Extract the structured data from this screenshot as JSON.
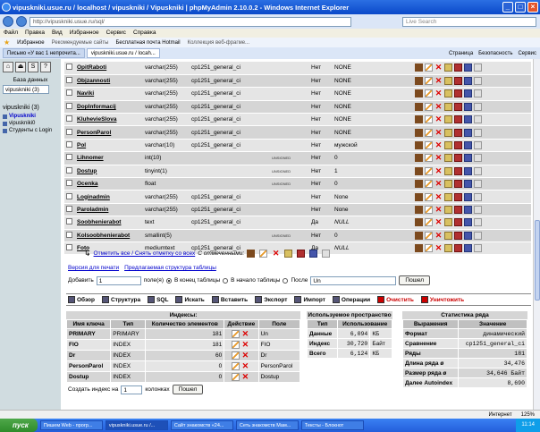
{
  "window": {
    "title": "vipuskniki.usue.ru / localhost / vipuskniki / Vipuskniki | phpMyAdmin 2.10.0.2 - Windows Internet Explorer"
  },
  "address": {
    "url": "http://vipuskniki.usue.ru/sql/",
    "search_placeholder": "Live Search"
  },
  "menu": [
    "Файл",
    "Правка",
    "Вид",
    "Избранное",
    "Сервис",
    "Справка"
  ],
  "favorites": {
    "label": "Избранное",
    "items": [
      "Рекомендуемые сайты",
      "Бесплатная почта Hotmail",
      "Коллекция веб-фрагме..."
    ]
  },
  "tabs": [
    {
      "label": "Письмо «У вас 1 непрочита..."
    },
    {
      "label": "vipuskniki.usue.ru / locah..."
    }
  ],
  "tools": [
    "Страница",
    "Безопасность",
    "Сервис"
  ],
  "left": {
    "db_label": "База данных",
    "db_select": "vipuskniki (3)",
    "db_title": "vipuskniki (3)",
    "tables": [
      "Vipuskniki",
      "vipuskniki0",
      "Студенты с Login"
    ]
  },
  "fields": [
    {
      "name": "OpitRaboti",
      "type": "varchar(255)",
      "collation": "cp1251_general_ci",
      "attr": "",
      "null": "Нет",
      "default": "NONE",
      "extra": ""
    },
    {
      "name": "Objzannosti",
      "type": "varchar(255)",
      "collation": "cp1251_general_ci",
      "attr": "",
      "null": "Нет",
      "default": "NONE",
      "extra": ""
    },
    {
      "name": "Naviki",
      "type": "varchar(255)",
      "collation": "cp1251_general_ci",
      "attr": "",
      "null": "Нет",
      "default": "NONE",
      "extra": ""
    },
    {
      "name": "DopInformacij",
      "type": "varchar(255)",
      "collation": "cp1251_general_ci",
      "attr": "",
      "null": "Нет",
      "default": "NONE",
      "extra": ""
    },
    {
      "name": "KluhevieSlova",
      "type": "varchar(255)",
      "collation": "cp1251_general_ci",
      "attr": "",
      "null": "Нет",
      "default": "NONE",
      "extra": ""
    },
    {
      "name": "PersonParol",
      "type": "varchar(255)",
      "collation": "cp1251_general_ci",
      "attr": "",
      "null": "Нет",
      "default": "NONE",
      "extra": ""
    },
    {
      "name": "Pol",
      "type": "varchar(10)",
      "collation": "cp1251_general_ci",
      "attr": "",
      "null": "Нет",
      "default": "мужской",
      "extra": ""
    },
    {
      "name": "Lihnomer",
      "type": "int(10)",
      "collation": "",
      "attr": "UNSIGNED",
      "null": "Нет",
      "default": "0",
      "extra": ""
    },
    {
      "name": "Dostup",
      "type": "tinyint(1)",
      "collation": "",
      "attr": "UNSIGNED",
      "null": "Нет",
      "default": "1",
      "extra": ""
    },
    {
      "name": "Ocenka",
      "type": "float",
      "collation": "",
      "attr": "UNSIGNED",
      "null": "Нет",
      "default": "0",
      "extra": ""
    },
    {
      "name": "Loginadmin",
      "type": "varchar(255)",
      "collation": "cp1251_general_ci",
      "attr": "",
      "null": "Нет",
      "default": "None",
      "extra": ""
    },
    {
      "name": "Paroladmin",
      "type": "varchar(255)",
      "collation": "cp1251_general_ci",
      "attr": "",
      "null": "Нет",
      "default": "None",
      "extra": ""
    },
    {
      "name": "Soobhenierabot",
      "type": "text",
      "collation": "cp1251_general_ci",
      "attr": "",
      "null": "Да",
      "default": "NULL",
      "extra": ""
    },
    {
      "name": "Kolsoobhenierabot",
      "type": "smallint(5)",
      "collation": "",
      "attr": "UNSIGNED",
      "null": "Нет",
      "default": "0",
      "extra": ""
    },
    {
      "name": "Foto",
      "type": "mediumtext",
      "collation": "cp1251_general_ci",
      "attr": "",
      "null": "Да",
      "default": "NULL",
      "extra": ""
    }
  ],
  "checkline": {
    "text": "Отметить все / Снять отметку со всех",
    "with_selected": "С отмеченными:"
  },
  "printline": {
    "print": "Версия для печати",
    "proposed": "Предлагаемая структура таблицы"
  },
  "addline": {
    "add": "Добавить",
    "count": "1",
    "fields": "поле(я)",
    "at_end": "В конец таблицы",
    "at_begin": "В начало таблицы",
    "after": "После",
    "after_select": "Un",
    "go": "Пошел"
  },
  "actions": [
    "Обзор",
    "Структура",
    "SQL",
    "Искать",
    "Вставить",
    "Экспорт",
    "Импорт",
    "Операции",
    "Очистить",
    "Уничтожить"
  ],
  "indexes": {
    "title": "Индексы:",
    "headers": [
      "Имя ключа",
      "Тип",
      "Количество элементов",
      "Действие",
      "Поле"
    ],
    "rows": [
      [
        "PRIMARY",
        "PRIMARY",
        "181",
        "Un"
      ],
      [
        "FIO",
        "INDEX",
        "181",
        "FIO"
      ],
      [
        "Dr",
        "INDEX",
        "60",
        "Dr"
      ],
      [
        "PersonParol",
        "INDEX",
        "0",
        "PersonParol"
      ],
      [
        "Dostup",
        "INDEX",
        "0",
        "Dostup"
      ]
    ],
    "create_label": "Создать индекс на",
    "create_count": "1",
    "create_cols": "колонках",
    "go": "Пошел"
  },
  "space": {
    "title": "Используемое пространство",
    "headers": [
      "Тип",
      "Использование"
    ],
    "rows": [
      [
        "Данные",
        "6,094",
        "КБ"
      ],
      [
        "Индекс",
        "30,720",
        "Байт"
      ],
      [
        "Всего",
        "6,124",
        "КБ"
      ]
    ]
  },
  "stats": {
    "title": "Статистика ряда",
    "headers": [
      "Выражения",
      "Значение"
    ],
    "rows": [
      [
        "Формат",
        "динамический"
      ],
      [
        "Сравнение",
        "cp1251_general_ci"
      ],
      [
        "Ряды",
        "181"
      ],
      [
        "Длина ряда ø",
        "34,476"
      ],
      [
        "Размер ряда ø",
        "34,646 Байт"
      ],
      [
        "Далее Autoindex",
        "8,690"
      ]
    ]
  },
  "iezone": {
    "status": "Интернет",
    "zoom": "125%"
  },
  "taskbar": {
    "start": "пуск",
    "items": [
      "Пишем Web - прогр...",
      "vipuskniki.usue.ru /...",
      "Сайт знакомств «24...",
      "Сеть знакомств Мам...",
      "Тексты - Блокнот"
    ],
    "clock": "11:14"
  }
}
